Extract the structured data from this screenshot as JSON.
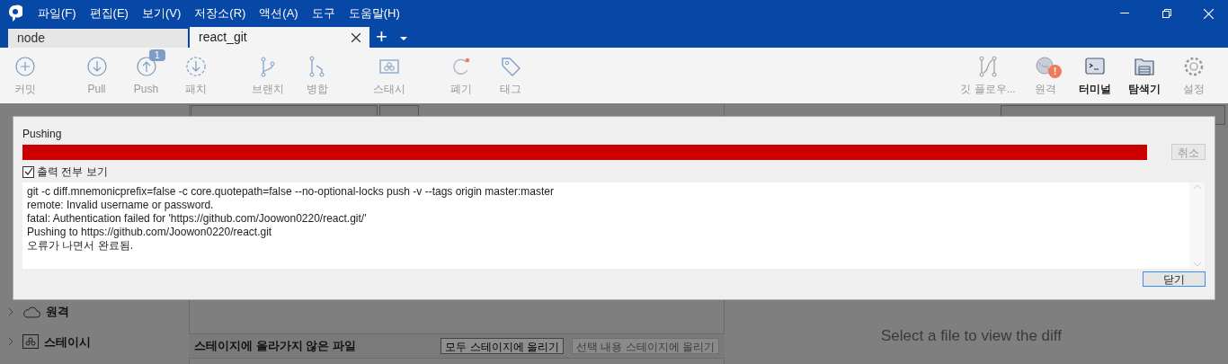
{
  "menu": [
    "파일(F)",
    "편집(E)",
    "보기(V)",
    "저장소(R)",
    "액션(A)",
    "도구",
    "도움말(H)"
  ],
  "tabs": [
    {
      "label": "node",
      "selected": false
    },
    {
      "label": "react_git",
      "selected": true
    }
  ],
  "new_tab": "+",
  "toolbar": {
    "left_groups": [
      [
        {
          "kind": "commit",
          "label": "커밋"
        }
      ],
      [
        {
          "kind": "pull",
          "label": "Pull"
        },
        {
          "kind": "push",
          "label": "Push",
          "badge": "1"
        },
        {
          "kind": "patch",
          "label": "패치"
        }
      ],
      [
        {
          "kind": "branch",
          "label": "브랜치"
        },
        {
          "kind": "merge",
          "label": "병합"
        }
      ],
      [
        {
          "kind": "stash",
          "label": "스태시"
        }
      ],
      [
        {
          "kind": "discard",
          "label": "폐기"
        },
        {
          "kind": "tag",
          "label": "태그"
        }
      ]
    ],
    "right": [
      {
        "kind": "flow",
        "label": "깃 플로우...",
        "bold": false
      },
      {
        "kind": "remote",
        "label": "원격",
        "badge": "!",
        "bold": false
      },
      {
        "kind": "terminal",
        "label": "터미널",
        "bold": true
      },
      {
        "kind": "explorer",
        "label": "탐색기",
        "bold": true
      },
      {
        "kind": "settings",
        "label": "설정",
        "bold": false
      }
    ]
  },
  "background": {
    "sidebar": [
      {
        "kind": "remote",
        "label": "원격"
      },
      {
        "kind": "stash",
        "label": "스테이시"
      }
    ],
    "unstaged_title": "스테이지에 올라가지 않은 파일",
    "unstaged_buttons": [
      {
        "label": "모두 스테이지에 올리기",
        "disabled": false
      },
      {
        "label": "선택 내용 스테이지에 올리기",
        "disabled": true
      }
    ],
    "diff_hint": "Select a file to view the diff"
  },
  "dialog": {
    "title": "Pushing",
    "progress": {
      "level": 1,
      "color": "#cc0000"
    },
    "cancel": "취소",
    "show_output": {
      "label": "출력 전부 보기",
      "checked": true
    },
    "output": [
      "git -c diff.mnemonicprefix=false -c core.quotepath=false --no-optional-locks push -v --tags origin master:master",
      "remote: Invalid username or password.",
      "fatal: Authentication failed for 'https://github.com/Joowon0220/react.git/'",
      "Pushing to https://github.com/Joowon0220/react.git",
      "오류가 나면서 완료됨."
    ],
    "close": "닫기"
  }
}
